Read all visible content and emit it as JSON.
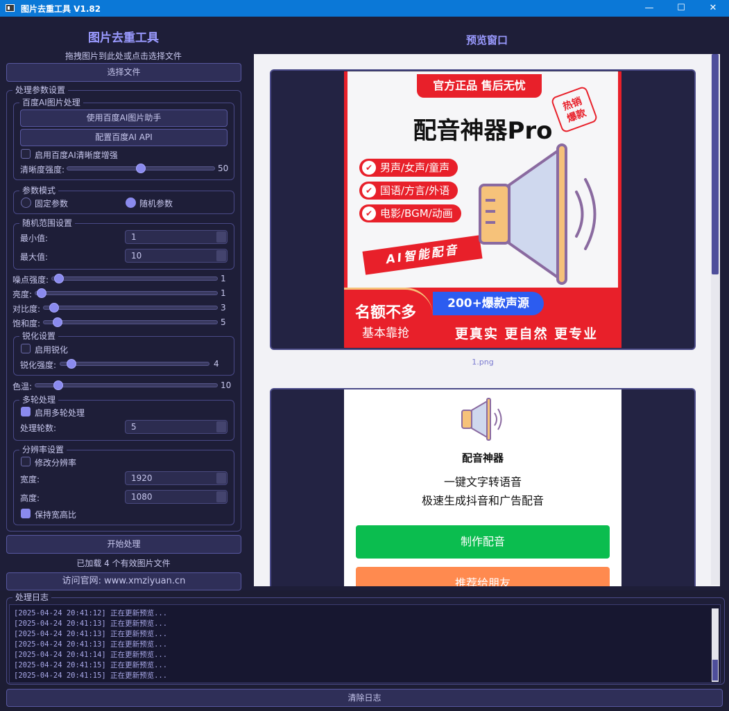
{
  "window": {
    "title": "图片去重工具 V1.82",
    "minimize": "—",
    "maximize": "☐",
    "close": "✕"
  },
  "left": {
    "title": "图片去重工具",
    "hint": "拖拽图片到此处或点击选择文件",
    "select_file": "选择文件",
    "params_group": "处理参数设置",
    "baidu_group": "百度AI图片处理",
    "baidu_helper": "使用百度AI图片助手",
    "baidu_config": "配置百度AI API",
    "baidu_enhance": "启用百度AI清晰度增强",
    "sharpness_label": "清晰度强度:",
    "sharpness_value": "50",
    "mode_group": "参数模式",
    "mode_fixed": "固定参数",
    "mode_random": "随机参数",
    "random_group": "随机范围设置",
    "min_label": "最小值:",
    "min_value": "1",
    "max_label": "最大值:",
    "max_value": "10",
    "noise_label": "噪点强度:",
    "noise_value": "1",
    "bright_label": "亮度:",
    "bright_value": "1",
    "contrast_label": "对比度:",
    "contrast_value": "3",
    "sat_label": "饱和度:",
    "sat_value": "5",
    "sharpen_group": "锐化设置",
    "sharpen_enable": "启用锐化",
    "sharpen_label": "锐化强度:",
    "sharpen_value": "4",
    "temp_label": "色温:",
    "temp_value": "10",
    "multi_group": "多轮处理",
    "multi_enable": "启用多轮处理",
    "rounds_label": "处理轮数:",
    "rounds_value": "5",
    "res_group": "分辨率设置",
    "res_enable": "修改分辨率",
    "width_label": "宽度:",
    "width_value": "1920",
    "height_label": "高度:",
    "height_value": "1080",
    "keep_ratio": "保持宽高比",
    "start": "开始处理",
    "status": "已加载 4 个有效图片文件",
    "website": "访问官网: www.xmziyuan.cn"
  },
  "preview": {
    "title": "预览窗口",
    "img1": {
      "filename": "1.png",
      "banner": "官方正品 售后无忧",
      "product": "配音神器Pro",
      "badge_top": "热销",
      "badge_bot": "爆款",
      "features": [
        "男声/女声/童声",
        "国语/方言/外语",
        "电影/BGM/动画"
      ],
      "ai_tag": "AI智能配音",
      "quota1": "名额不多",
      "quota2": "基本靠抢",
      "sources": "200+爆款声源",
      "slogan": "更真实 更自然 更专业"
    },
    "img2": {
      "name": "配音神器",
      "line1": "一键文字转语音",
      "line2": "极速生成抖音和广告配音",
      "btn_make": "制作配音",
      "btn_share": "推荐给朋友"
    }
  },
  "log": {
    "title": "处理日志",
    "lines": [
      "[2025-04-24 20:41:12] 正在更新预览...",
      "[2025-04-24 20:41:13] 正在更新预览...",
      "[2025-04-24 20:41:13] 正在更新预览...",
      "[2025-04-24 20:41:13] 正在更新预览...",
      "[2025-04-24 20:41:14] 正在更新预览...",
      "[2025-04-24 20:41:15] 正在更新预览...",
      "[2025-04-24 20:41:15] 正在更新预览..."
    ],
    "clear": "清除日志"
  },
  "colors": {
    "accent": "#8a8aee",
    "title_bar": "#0b78d7",
    "poster_red": "#e8202a",
    "green": "#0bbd4f",
    "orange": "#ff8a4f"
  },
  "icons": [
    "app-icon",
    "speaker-icon",
    "check-icon"
  ]
}
